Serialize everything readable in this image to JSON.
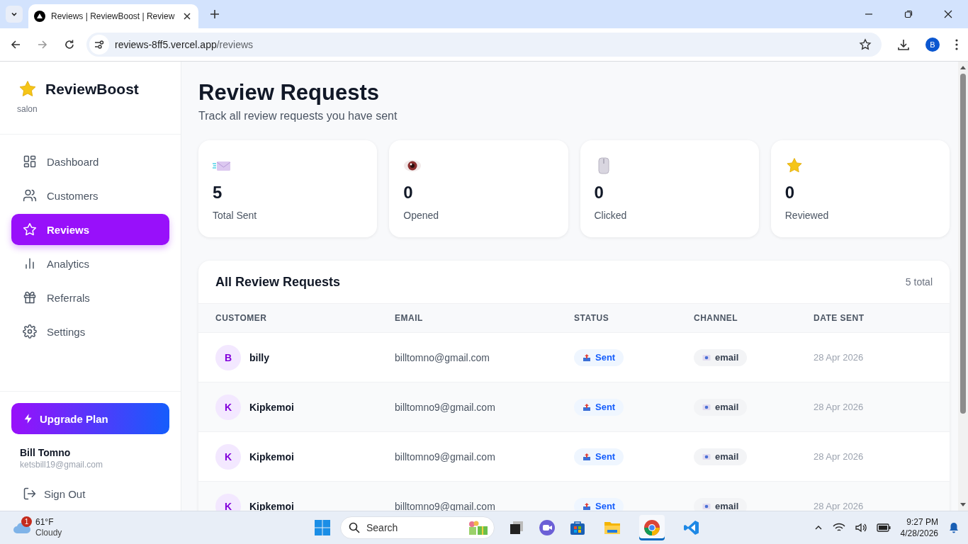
{
  "browser": {
    "tab_title": "Reviews | ReviewBoost | Review",
    "url_host": "reviews-8ff5.vercel.app",
    "url_path": "/reviews",
    "profile_initial": "B"
  },
  "sidebar": {
    "brand": "ReviewBoost",
    "subtitle": "salon",
    "nav": [
      {
        "kind": "dashboard",
        "label": "Dashboard",
        "selected": false
      },
      {
        "kind": "customers",
        "label": "Customers",
        "selected": false
      },
      {
        "kind": "reviews",
        "label": "Reviews",
        "selected": true
      },
      {
        "kind": "analytics",
        "label": "Analytics",
        "selected": false
      },
      {
        "kind": "referrals",
        "label": "Referrals",
        "selected": false
      },
      {
        "kind": "settings",
        "label": "Settings",
        "selected": false
      }
    ],
    "upgrade": "Upgrade Plan",
    "user": {
      "name": "Bill Tomno",
      "email": "ketsbill19@gmail.com"
    },
    "signout": "Sign Out"
  },
  "page": {
    "title": "Review Requests",
    "subtitle": "Track all review requests you have sent"
  },
  "stats": [
    {
      "kind": "sent",
      "value": "5",
      "label": "Total Sent"
    },
    {
      "kind": "opened",
      "value": "0",
      "label": "Opened"
    },
    {
      "kind": "clicked",
      "value": "0",
      "label": "Clicked"
    },
    {
      "kind": "reviewed",
      "value": "0",
      "label": "Reviewed"
    }
  ],
  "table": {
    "title": "All Review Requests",
    "count": "5 total",
    "columns": [
      "CUSTOMER",
      "EMAIL",
      "STATUS",
      "CHANNEL",
      "DATE SENT"
    ],
    "rows": [
      {
        "initial": "B",
        "customer": "billy",
        "email": "billtomno@gmail.com",
        "status": "Sent",
        "channel": "email",
        "date": "28 Apr 2026"
      },
      {
        "initial": "K",
        "customer": "Kipkemoi",
        "email": "billtomno9@gmail.com",
        "status": "Sent",
        "channel": "email",
        "date": "28 Apr 2026"
      },
      {
        "initial": "K",
        "customer": "Kipkemoi",
        "email": "billtomno9@gmail.com",
        "status": "Sent",
        "channel": "email",
        "date": "28 Apr 2026"
      },
      {
        "initial": "K",
        "customer": "Kipkemoi",
        "email": "billtomno9@gmail.com",
        "status": "Sent",
        "channel": "email",
        "date": "28 Apr 2026"
      }
    ]
  },
  "taskbar": {
    "weather_badge": "1",
    "temp": "61°F",
    "condition": "Cloudy",
    "search_placeholder": "Search",
    "time": "9:27 PM",
    "date": "4/28/2026"
  }
}
